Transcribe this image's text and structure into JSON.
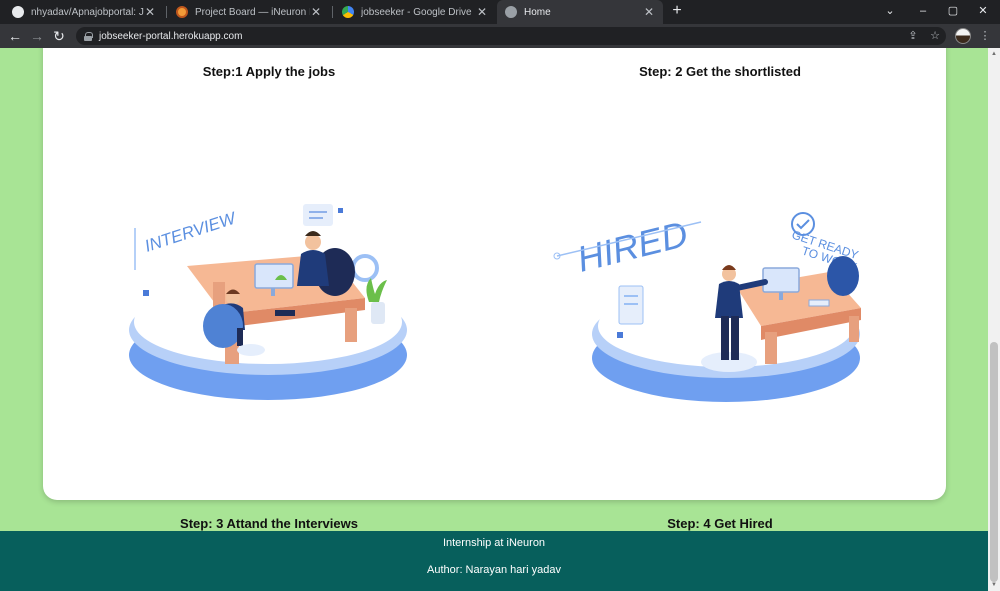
{
  "browser": {
    "tabs": [
      {
        "title": "nhyadav/Apnajobportal: Jobse",
        "icon": "github-icon",
        "active": false
      },
      {
        "title": "Project Board — iNeuron Interns",
        "icon": "ineuron-icon",
        "active": false
      },
      {
        "title": "jobseeker - Google Drive",
        "icon": "google-drive-icon",
        "active": false
      },
      {
        "title": "Home",
        "icon": "globe-icon",
        "active": true
      }
    ],
    "url": "jobseeker-portal.herokuapp.com"
  },
  "steps": {
    "step1": "Step:1 Apply the jobs",
    "step2": "Step: 2 Get the shortlisted",
    "step3": "Step: 3 Attand the Interviews",
    "step4": "Step: 4 Get Hired"
  },
  "illustrations": {
    "interview": {
      "text": "INTERVIEW"
    },
    "hired": {
      "text": "HIRED",
      "sign_line1": "GET READY",
      "sign_line2": "TO WORK"
    }
  },
  "footer": {
    "line1": "Internship at iNeuron",
    "line2": "Author: Narayan hari yadav"
  }
}
